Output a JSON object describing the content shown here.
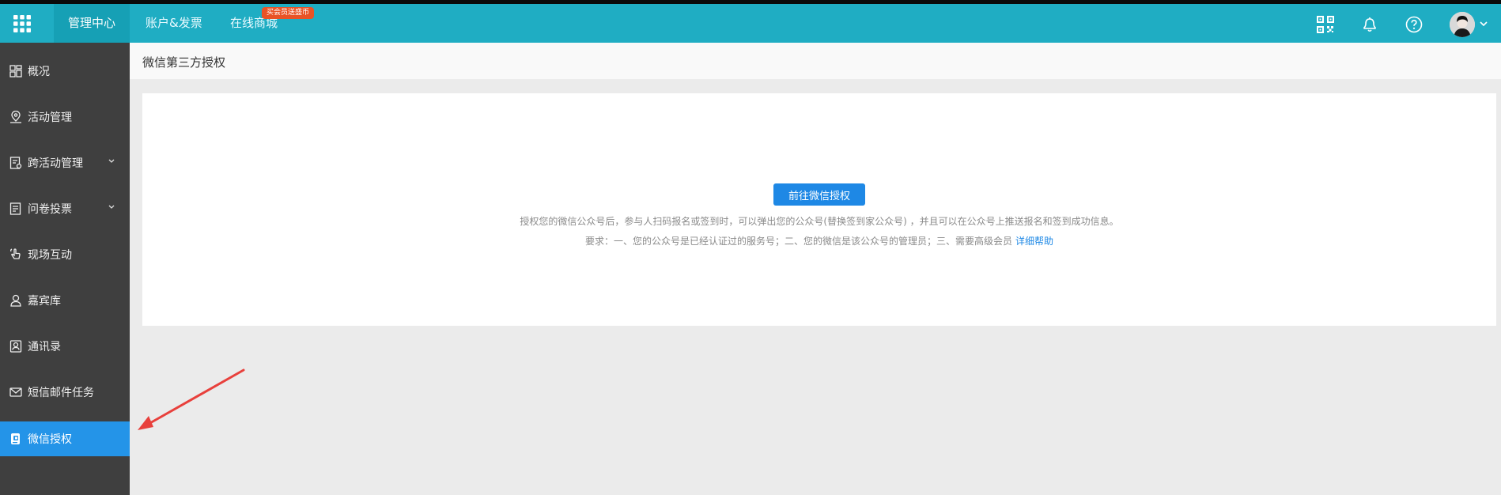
{
  "topbar": {
    "tabs": [
      {
        "label": "管理中心"
      },
      {
        "label": "账户&发票"
      },
      {
        "label": "在线商城"
      }
    ],
    "badge": "买会员送盛币",
    "icons": [
      "grid-icon",
      "qr-code-icon",
      "bell-icon",
      "help-icon",
      "user-avatar",
      "caret-down-icon"
    ]
  },
  "sidebar": {
    "items": [
      {
        "label": "概况",
        "icon": "dashboard-icon"
      },
      {
        "label": "活动管理",
        "icon": "location-icon"
      },
      {
        "label": "跨活动管理",
        "icon": "document-settings-icon"
      },
      {
        "label": "问卷投票",
        "icon": "vote-icon"
      },
      {
        "label": "现场互动",
        "icon": "interaction-icon"
      },
      {
        "label": "嘉宾库",
        "icon": "guest-icon"
      },
      {
        "label": "通讯录",
        "icon": "contacts-icon"
      },
      {
        "label": "短信邮件任务",
        "icon": "mail-icon"
      },
      {
        "label": "微信授权",
        "icon": "wechat-auth-icon"
      }
    ]
  },
  "page": {
    "title": "微信第三方授权",
    "button_label": "前往微信授权",
    "description": "授权您的微信公众号后，参与人扫码报名或签到时，可以弹出您的公众号(替换签到家公众号) ，并且可以在公众号上推送报名和签到成功信息。",
    "requirements": "要求：一、您的公众号是已经认证过的服务号；二、您的微信是该公众号的管理员；三、需要高级会员",
    "help_link": "详细帮助"
  },
  "colors": {
    "topbar": "#1fadc3",
    "topbar_active": "#16a0b5",
    "sidebar": "#3f3f3f",
    "sidebar_active": "#2494e8",
    "primary_button": "#1e88e5",
    "badge": "#e95326",
    "annotation_arrow": "#e8403c"
  }
}
